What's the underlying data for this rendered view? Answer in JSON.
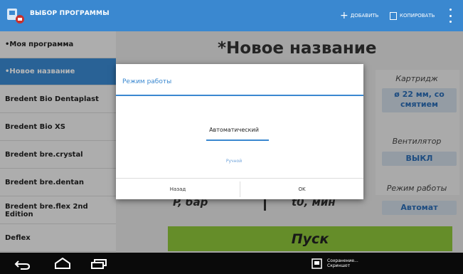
{
  "topbar": {
    "title": "ВЫБОР ПРОГРАММЫ",
    "add_label": "ДОБАВИТЬ",
    "copy_label": "КОПИРОВАТЬ",
    "background": "#3a88d0"
  },
  "program_list": {
    "items": [
      {
        "label": "•Моя программа",
        "selected": false
      },
      {
        "label": "•Новое название",
        "selected": true
      },
      {
        "label": "Bredent Bio Dentaplast",
        "selected": false
      },
      {
        "label": "Bredent Bio XS",
        "selected": false
      },
      {
        "label": "Bredent bre.crystal",
        "selected": false
      },
      {
        "label": "Bredent bre.dentan",
        "selected": false
      },
      {
        "label": "Bredent bre.flex 2nd Edition",
        "selected": false
      },
      {
        "label": "Deflex",
        "selected": false
      }
    ]
  },
  "program": {
    "title": "*Новое название",
    "cartridge_label": "Картридж",
    "cartridge_value_line1": "ø 22 мм, со",
    "cartridge_value_line2": "смятием",
    "fan_label": "Вентилятор",
    "fan_value": "ВЫКЛ",
    "mode_label": "Режим работы",
    "mode_value": "Автомат",
    "pressure_header": "P, бар",
    "time_header": "t0, мин",
    "start_label": "Пуск",
    "start_color": "#8cc43a"
  },
  "dialog": {
    "title": "Режим работы",
    "selected_option": "Автоматический",
    "other_option": "Ручной",
    "cancel_label": "Назад",
    "ok_label": "OK"
  },
  "navbar": {
    "notification_line1": "Сохранение...",
    "notification_line2": "Скриншот"
  }
}
